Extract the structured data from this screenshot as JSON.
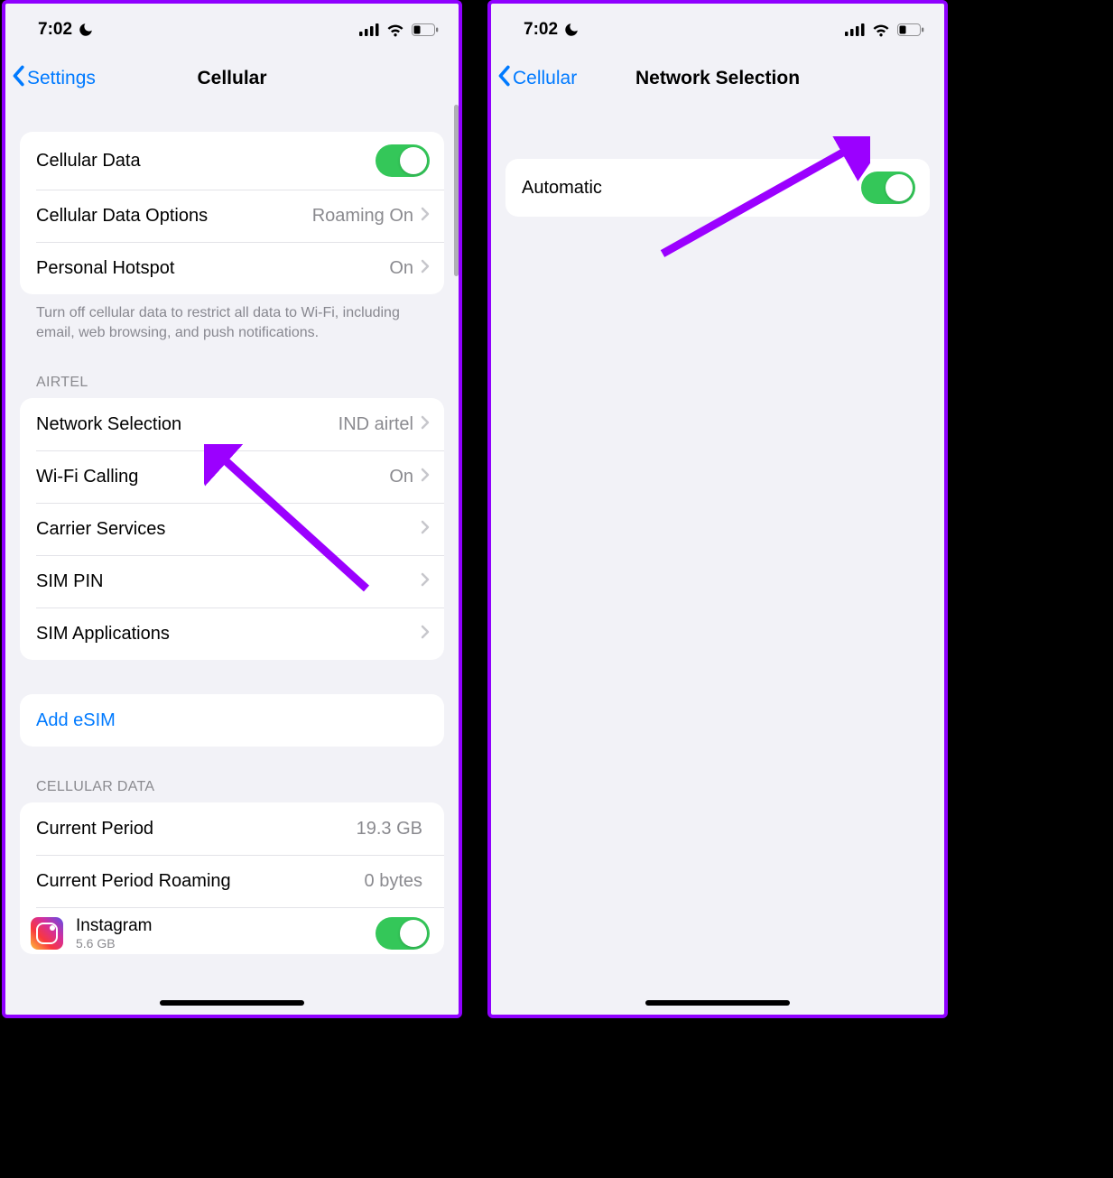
{
  "status": {
    "time": "7:02"
  },
  "left": {
    "nav": {
      "back": "Settings",
      "title": "Cellular"
    },
    "rows1": {
      "cellular_data": "Cellular Data",
      "cellular_data_options": "Cellular Data Options",
      "cellular_data_options_detail": "Roaming On",
      "personal_hotspot": "Personal Hotspot",
      "personal_hotspot_detail": "On"
    },
    "footer1": "Turn off cellular data to restrict all data to Wi-Fi, including email, web browsing, and push notifications.",
    "carrier_header": "AIRTEL",
    "rows2": {
      "network_selection": "Network Selection",
      "network_selection_detail": "IND airtel",
      "wifi_calling": "Wi-Fi Calling",
      "wifi_calling_detail": "On",
      "carrier_services": "Carrier Services",
      "sim_pin": "SIM PIN",
      "sim_applications": "SIM Applications"
    },
    "add_esim": "Add eSIM",
    "cellular_data_header": "CELLULAR DATA",
    "rows3": {
      "current_period": "Current Period",
      "current_period_value": "19.3 GB",
      "current_period_roaming": "Current Period Roaming",
      "current_period_roaming_value": "0 bytes",
      "app_name": "Instagram",
      "app_size": "5.6 GB"
    }
  },
  "right": {
    "nav": {
      "back": "Cellular",
      "title": "Network Selection"
    },
    "row": {
      "automatic": "Automatic"
    }
  }
}
